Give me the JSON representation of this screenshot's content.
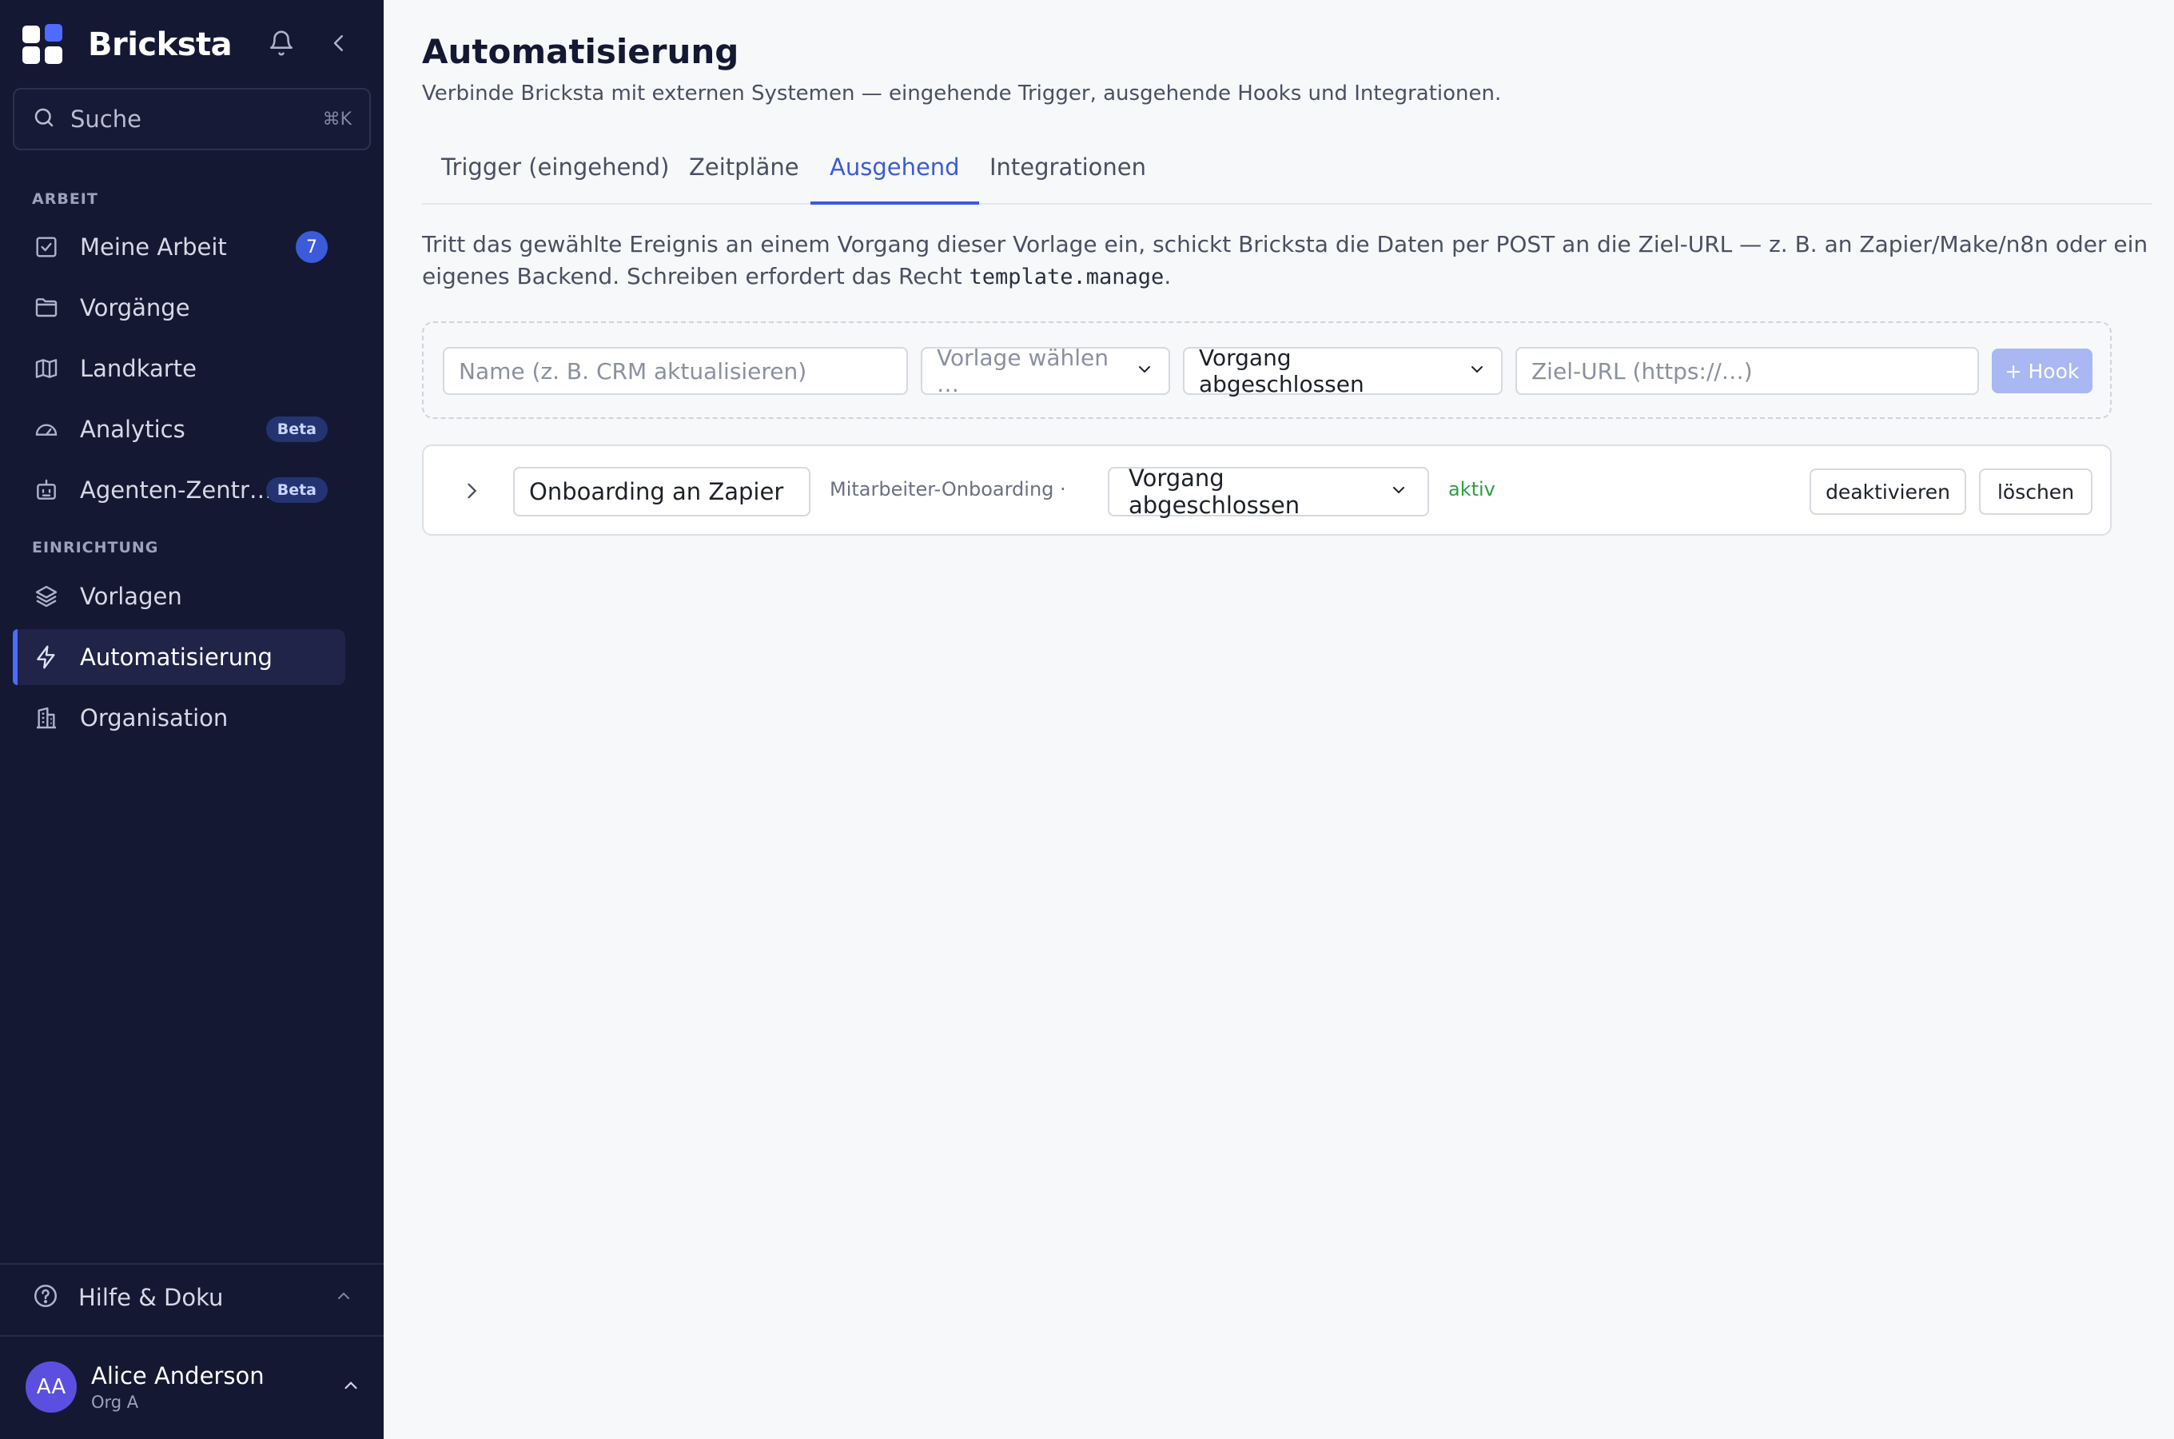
{
  "app": {
    "name": "Bricksta"
  },
  "sidebar": {
    "search": {
      "label": "Suche",
      "shortcut": "⌘K"
    },
    "sections": [
      {
        "title": "ARBEIT",
        "items": [
          {
            "label": "Meine Arbeit",
            "icon": "checkbox-icon",
            "badge": "7"
          },
          {
            "label": "Vorgänge",
            "icon": "folder-icon"
          },
          {
            "label": "Landkarte",
            "icon": "map-icon"
          },
          {
            "label": "Analytics",
            "icon": "gauge-icon",
            "badge": "Beta"
          },
          {
            "label": "Agenten-Zentr…",
            "icon": "robot-icon",
            "badge": "Beta"
          }
        ]
      },
      {
        "title": "EINRICHTUNG",
        "items": [
          {
            "label": "Vorlagen",
            "icon": "layers-icon"
          },
          {
            "label": "Automatisierung",
            "icon": "lightning-icon",
            "active": true
          },
          {
            "label": "Organisation",
            "icon": "building-icon"
          }
        ]
      }
    ],
    "help": {
      "label": "Hilfe & Doku"
    },
    "user": {
      "initials": "AA",
      "name": "Alice Anderson",
      "org": "Org A"
    }
  },
  "page": {
    "title": "Automatisierung",
    "subtitle": "Verbinde Bricksta mit externen Systemen — eingehende Trigger, ausgehende Hooks und Integrationen.",
    "tabs": [
      {
        "label": "Trigger (eingehend)"
      },
      {
        "label": "Zeitpläne"
      },
      {
        "label": "Ausgehend",
        "active": true
      },
      {
        "label": "Integrationen"
      }
    ],
    "description": {
      "text": "Tritt das gewählte Ereignis an einem Vorgang dieser Vorlage ein, schickt Bricksta die Daten per POST an die Ziel-URL — z. B. an Zapier/Make/n8n oder ein eigenes Backend. Schreiben erfordert das Recht ",
      "code": "template.manage",
      "suffix": "."
    },
    "create_form": {
      "name_placeholder": "Name (z. B. CRM aktualisieren)",
      "template_placeholder": "Vorlage wählen …",
      "event_value": "Vorgang abgeschlossen",
      "url_placeholder": "Ziel-URL (https://…)",
      "add_button": "+ Hook"
    },
    "hooks": [
      {
        "name": "Onboarding an Zapier",
        "template": "Mitarbeiter-Onboarding ·",
        "event": "Vorgang abgeschlossen",
        "status": "aktiv",
        "deactivate_label": "deaktivieren",
        "delete_label": "löschen"
      }
    ]
  },
  "colors": {
    "sidebar_bg": "#141833",
    "accent": "#3b5bdb",
    "status_active": "#2f9e44"
  }
}
